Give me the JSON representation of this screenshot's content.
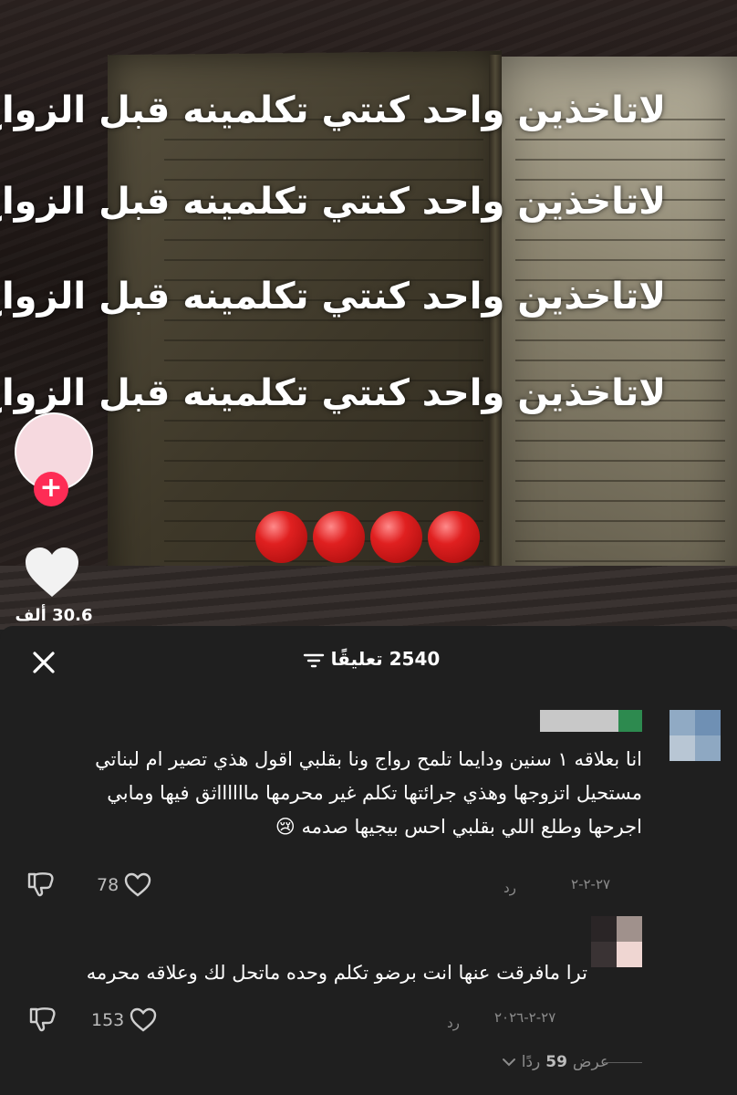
{
  "video": {
    "overlay_lines": [
      "لاتاخذين واحد كنتي تكلمينه قبل الزواج",
      "لاتاخذين واحد كنتي تكلمينه قبل الزواج",
      "لاتاخذين واحد كنتي تكلمينه قبل الزواج",
      "لاتاخذين واحد كنتي تكلمينه قبل الزواج"
    ],
    "emoji_row": "🔴🔴🔴🔴",
    "like_count": "30.6 ألف"
  },
  "comments_panel": {
    "count_label": "2540 تعليقًا",
    "comments": [
      {
        "text": "انا بعلاقه ١ سنين ودايما تلمح رواج ونا بقلبي اقول هذي تصير ام لبناتي مستحيل اتزوجها وهذي جرائتها تكلم غير محرمها مااااااثق فيها ومابي اجرحها وطلع اللي بقلبي احس بيجيها صدمه 😢",
        "date": "٢٧-٢-٢",
        "reply_label": "رد",
        "likes": "78"
      },
      {
        "text": "ترا مافرقت عنها انت برضو تكلم وحده ماتحل لك وعلاقه محرمه",
        "date": "٢٧-٢-٢٠٢٦",
        "reply_label": "رد",
        "likes": "153"
      }
    ],
    "view_replies": {
      "prefix": "عرض",
      "count": "59",
      "suffix": "ردًا"
    }
  },
  "colors": {
    "panel_bg": "#1f1f1f",
    "accent_pink": "#fe2c55",
    "muted_text": "#8c8c8c"
  },
  "icons": [
    "close-icon",
    "filter-icon",
    "heart-icon",
    "dislike-icon",
    "chevron-down-icon",
    "plus-icon"
  ]
}
